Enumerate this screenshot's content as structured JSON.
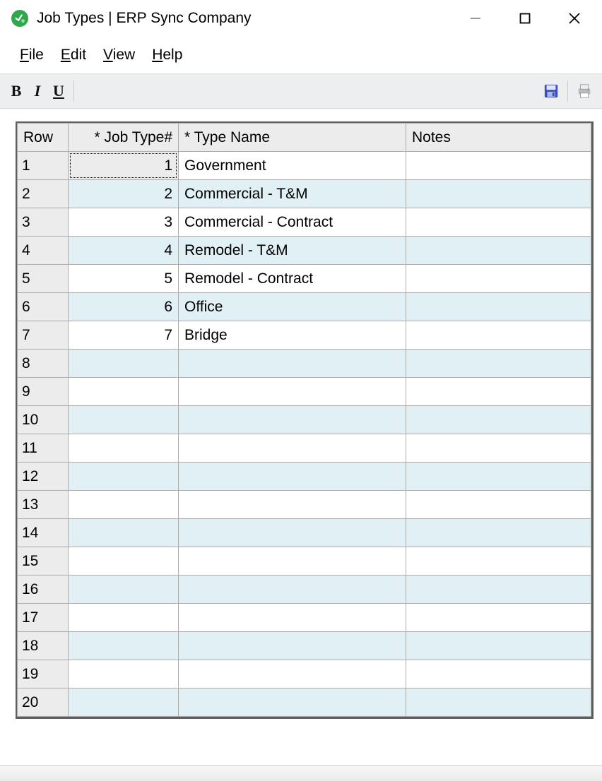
{
  "window": {
    "title": "Job Types | ERP Sync Company"
  },
  "menu": {
    "file": "File",
    "edit": "Edit",
    "view": "View",
    "help": "Help"
  },
  "grid": {
    "headers": {
      "row": "Row",
      "jobtype": "* Job Type#",
      "typename": "* Type Name",
      "notes": "Notes"
    },
    "total_rows": 20,
    "rows": [
      {
        "row": "1",
        "jobtype": "1",
        "typename": "Government",
        "notes": ""
      },
      {
        "row": "2",
        "jobtype": "2",
        "typename": "Commercial - T&M",
        "notes": ""
      },
      {
        "row": "3",
        "jobtype": "3",
        "typename": "Commercial - Contract",
        "notes": ""
      },
      {
        "row": "4",
        "jobtype": "4",
        "typename": "Remodel - T&M",
        "notes": ""
      },
      {
        "row": "5",
        "jobtype": "5",
        "typename": "Remodel - Contract",
        "notes": ""
      },
      {
        "row": "6",
        "jobtype": "6",
        "typename": "Office",
        "notes": ""
      },
      {
        "row": "7",
        "jobtype": "7",
        "typename": "Bridge",
        "notes": ""
      },
      {
        "row": "8",
        "jobtype": "",
        "typename": "",
        "notes": ""
      },
      {
        "row": "9",
        "jobtype": "",
        "typename": "",
        "notes": ""
      },
      {
        "row": "10",
        "jobtype": "",
        "typename": "",
        "notes": ""
      },
      {
        "row": "11",
        "jobtype": "",
        "typename": "",
        "notes": ""
      },
      {
        "row": "12",
        "jobtype": "",
        "typename": "",
        "notes": ""
      },
      {
        "row": "13",
        "jobtype": "",
        "typename": "",
        "notes": ""
      },
      {
        "row": "14",
        "jobtype": "",
        "typename": "",
        "notes": ""
      },
      {
        "row": "15",
        "jobtype": "",
        "typename": "",
        "notes": ""
      },
      {
        "row": "16",
        "jobtype": "",
        "typename": "",
        "notes": ""
      },
      {
        "row": "17",
        "jobtype": "",
        "typename": "",
        "notes": ""
      },
      {
        "row": "18",
        "jobtype": "",
        "typename": "",
        "notes": ""
      },
      {
        "row": "19",
        "jobtype": "",
        "typename": "",
        "notes": ""
      },
      {
        "row": "20",
        "jobtype": "",
        "typename": "",
        "notes": ""
      }
    ],
    "selected_cell": {
      "row_index": 0,
      "col": "jobtype"
    }
  }
}
